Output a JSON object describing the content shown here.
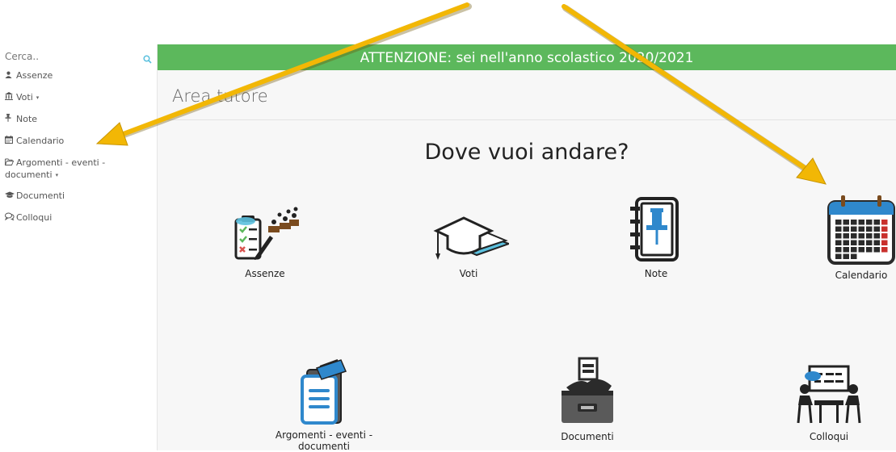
{
  "sidebar": {
    "search": {
      "placeholder": "Cerca.."
    },
    "items": [
      {
        "label": "Assenze",
        "icon": "user-icon"
      },
      {
        "label": "Voti",
        "icon": "bank-icon",
        "caret": "▾"
      },
      {
        "label": "Note",
        "icon": "pin-icon"
      },
      {
        "label": "Calendario",
        "icon": "calendar-icon"
      },
      {
        "label": "Argomenti - eventi - documenti",
        "icon": "folder-open-icon",
        "caret": "▾"
      },
      {
        "label": "Documenti",
        "icon": "graduation-cap-icon"
      },
      {
        "label": "Colloqui",
        "icon": "comments-icon"
      }
    ]
  },
  "banner": {
    "text": "ATTENZIONE: sei nell'anno scolastico 2020/2021",
    "color": "#5cb85c"
  },
  "header": {
    "title": "Area tutore"
  },
  "main": {
    "question": "Dove vuoi andare?",
    "tiles": [
      {
        "label": "Assenze",
        "icon": "attendance-register-icon"
      },
      {
        "label": "Voti",
        "icon": "diploma-cap-icon"
      },
      {
        "label": "Note",
        "icon": "notebook-pin-icon"
      },
      {
        "label": "Calendario",
        "icon": "calendar-grid-icon"
      },
      {
        "label": "Argomenti - eventi - documenti",
        "icon": "document-event-icon"
      },
      {
        "label": "Documenti",
        "icon": "file-drawer-icon"
      },
      {
        "label": "Colloqui",
        "icon": "meeting-board-icon"
      }
    ]
  },
  "annotation": {
    "arrow_color": "#f2b705"
  }
}
